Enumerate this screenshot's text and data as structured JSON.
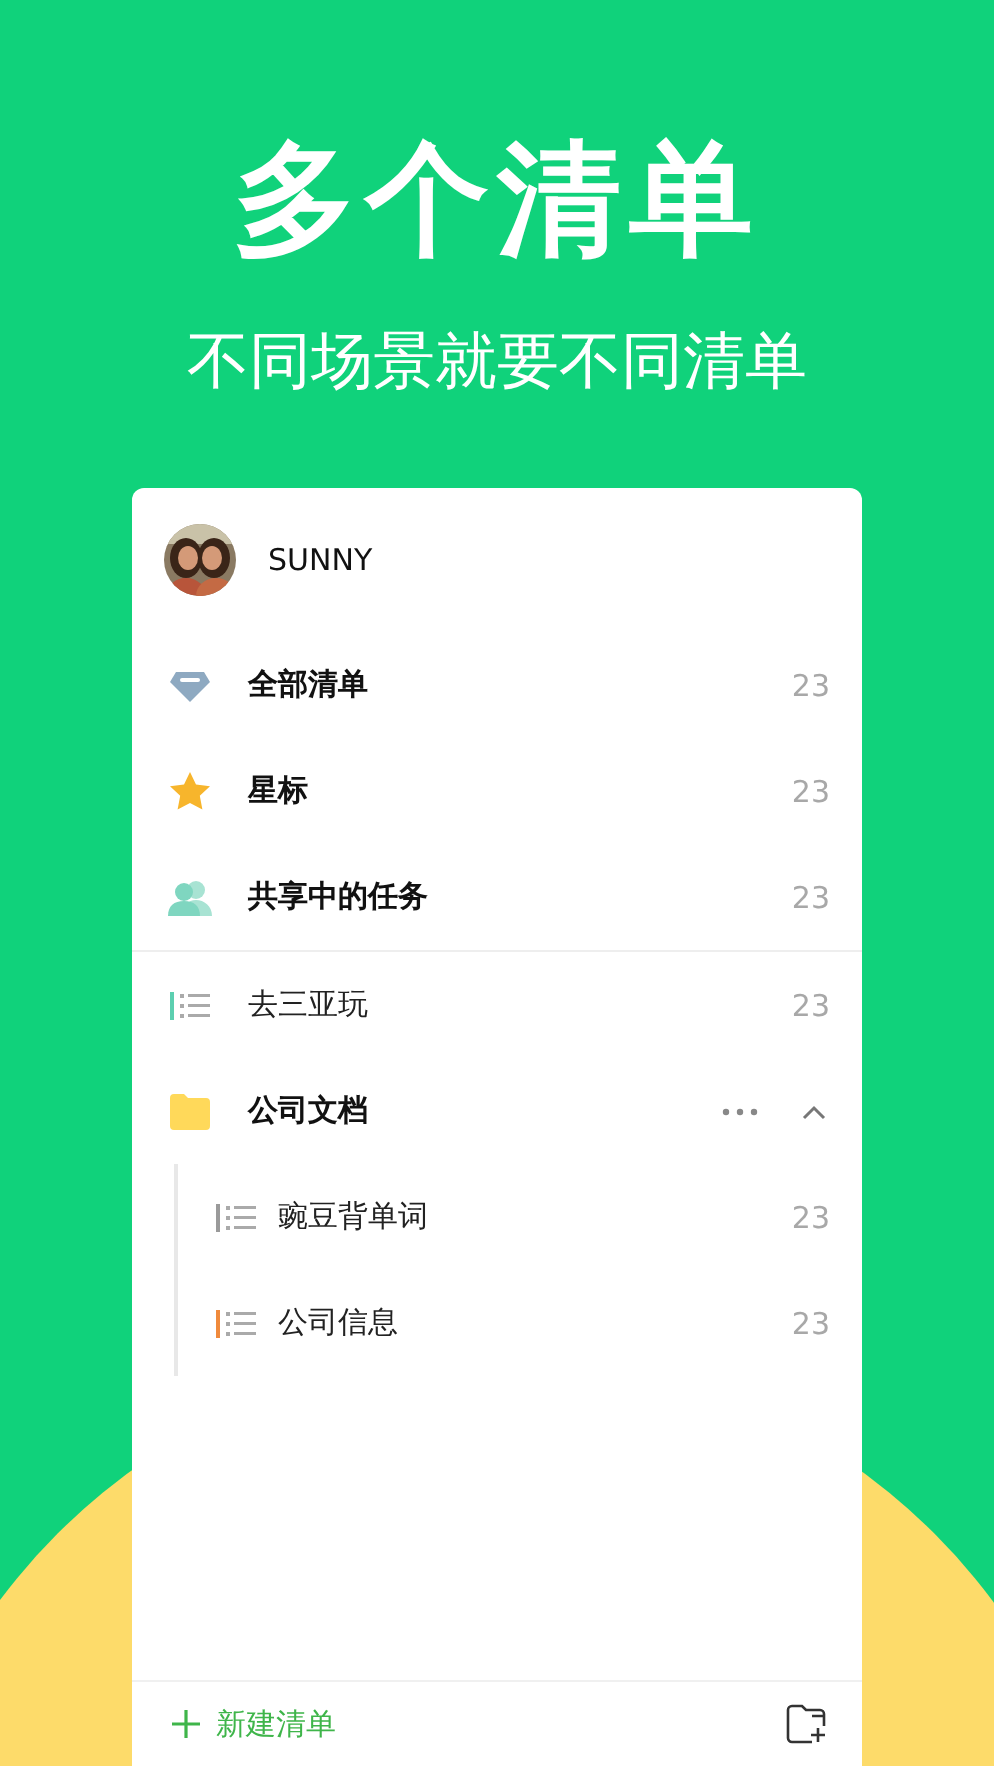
{
  "hero": {
    "title": "多个清单",
    "subtitle": "不同场景就要不同清单"
  },
  "user": {
    "name": "SUNNY"
  },
  "smart_lists": [
    {
      "kind": "all",
      "label": "全部清单",
      "count": "23"
    },
    {
      "kind": "starred",
      "label": "星标",
      "count": "23"
    },
    {
      "kind": "shared",
      "label": "共享中的任务",
      "count": "23"
    }
  ],
  "lists": [
    {
      "kind": "list",
      "label": "去三亚玩",
      "count": "23",
      "color": "#5ccfb0"
    },
    {
      "kind": "folder",
      "label": "公司文档",
      "expanded": true,
      "children": [
        {
          "label": "豌豆背单词",
          "count": "23",
          "color": "#9a9a9a"
        },
        {
          "label": "公司信息",
          "count": "23",
          "color": "#f08a3c"
        }
      ]
    }
  ],
  "footer": {
    "new_list": "新建清单"
  }
}
